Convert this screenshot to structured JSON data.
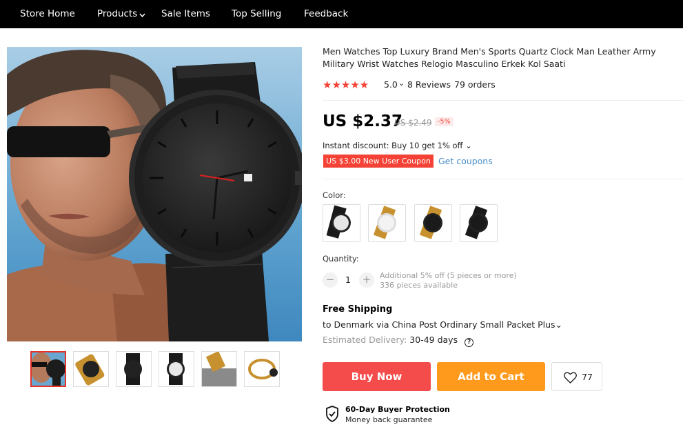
{
  "nav": {
    "items": [
      "Store Home",
      "Products",
      "Sale Items",
      "Top Selling",
      "Feedback"
    ]
  },
  "product": {
    "title": "Men Watches Top Luxury Brand Men's Sports Quartz Clock Man Leather Army Military Wrist Watches Relogio Masculino Erkek Kol Saati",
    "rating": "5.0",
    "reviews": "8 Reviews",
    "orders": "79 orders",
    "price": "US $2.37",
    "old_price": "US $2.49",
    "discount": "-5%",
    "instant_discount": "Instant discount: Buy 10 get 1% off",
    "coupon": "US $3.00 New User Coupon",
    "get_coupons": "Get coupons",
    "color_label": "Color:",
    "quantity_label": "Quantity:",
    "quantity": "1",
    "qty_note_1": "Additional 5% off (5 pieces or more)",
    "qty_note_2": "336 pieces available"
  },
  "shipping": {
    "title": "Free Shipping",
    "to": "to Denmark via China Post Ordinary Small Packet Plus",
    "est_label": "Estimated Delivery:",
    "est_days": "30-49 days"
  },
  "actions": {
    "buy_now": "Buy Now",
    "add_to_cart": "Add to Cart",
    "wishlist_count": "77"
  },
  "protection": {
    "title": "60-Day Buyer Protection",
    "subtitle": "Money back guarantee"
  },
  "colors": {
    "accent_red": "#f44336",
    "buy_button": "#f44b4b",
    "cart_button": "#ff9a1c",
    "link_blue": "#4a8ec9"
  }
}
